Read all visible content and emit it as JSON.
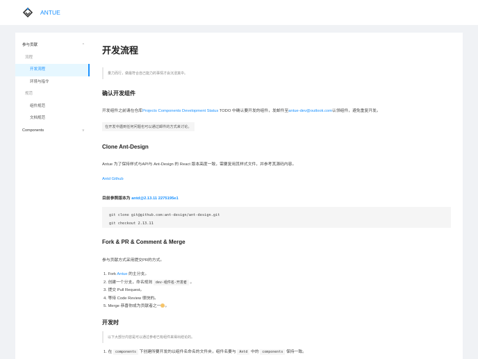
{
  "header": {
    "brand": "ANTUE"
  },
  "sidebar": {
    "items": [
      {
        "label": "参与贡献",
        "level": 0,
        "chevron": "^"
      },
      {
        "label": "流程",
        "level": 1
      },
      {
        "label": "开发流程",
        "level": 2,
        "active": true
      },
      {
        "label": "环境与指令",
        "level": 2
      },
      {
        "label": "规范",
        "level": 1
      },
      {
        "label": "组件规范",
        "level": 2
      },
      {
        "label": "文档规范",
        "level": 2
      },
      {
        "label": "Components",
        "level": 0,
        "chevron": "v"
      }
    ]
  },
  "main": {
    "title": "开发流程",
    "quote1": "量力而行，做最符合自己能力的事情才会沉浸其中。",
    "s1": {
      "heading": "确认开发组件",
      "p_pre": "开发组件之前请在仓库",
      "link1": "Projects Components Development Status",
      "p_mid": " TODO 中确认要开发的组件，发邮件至",
      "email": "antue-dev@outlook.com",
      "p_post": "认领组件，避免重复开发。",
      "note": "在开发中遇到任何问题也可以通过邮件的方式来讨论。"
    },
    "s2": {
      "heading": "Clone Ant-Design",
      "p": "Antue 为了保持样式与API与 Ant-Design 的 React 版本高度一致，需要复用其样式文件，并参考其源码内容。",
      "link": "Antd Github",
      "version_label": "目前参照版本为 ",
      "version_link": "antd@2.13.11 2275195e1",
      "code": [
        "git clone git@github.com:ant-design/ant-design.git",
        "git checkout 2.13.11"
      ]
    },
    "s3": {
      "heading": "Fork & PR & Comment & Merge",
      "p": "参与贡献方式采用提交PR的方式。",
      "list": [
        {
          "num": "1.",
          "pre": "Fork ",
          "link": "Antue",
          "post": " 的主分支。"
        },
        {
          "num": "2.",
          "pre": "创建一个分支，命名规则 ",
          "code": "dev-组件名-开发者",
          "post": " 。"
        },
        {
          "num": "3.",
          "pre": "提交 Pull Request。"
        },
        {
          "num": "4.",
          "pre": "等待 Code Review 很快的。"
        },
        {
          "num": "5.",
          "pre": "Merge 恭喜你成为贡献者之一",
          "post": "。"
        }
      ]
    },
    "s4": {
      "heading": "开发时",
      "quote": "以下大部分内容是可以通过参考已有组件来得出结论的。",
      "item1": {
        "num": "1.",
        "a": "在 ",
        "code1": "components",
        "b": " 下创建所要开发的以组件名命名的文件夹，组件名要与 ",
        "code2": "Antd",
        "c": " 中的 ",
        "code3": "components",
        "d": " 保持一致。"
      }
    }
  }
}
